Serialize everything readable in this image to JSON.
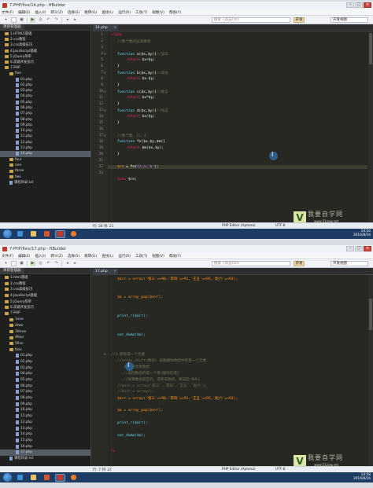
{
  "colors": {
    "editor_bg": "#272822",
    "keyword": "#f92672",
    "function": "#66d9ef",
    "comment": "#75715e",
    "string": "#e6db74",
    "variable": "#fd971f",
    "number": "#ae81ff",
    "taskbar": "#1d3b63"
  },
  "shot1": {
    "window_title": "7-PHP/five/14.php - HBuilder",
    "menu": [
      "文件(F)",
      "编辑(E)",
      "插入(I)",
      "转义(Z)",
      "选择(S)",
      "跳转(G)",
      "查找(L)",
      "运行(R)",
      "工具(T)",
      "视图(V)",
      "帮助(Y)"
    ],
    "search_placeholder": "搜索（双击Ctrl）",
    "mode_button": "开发",
    "view_select": "开发视图",
    "panel_title": "项目管理器",
    "tree": [
      "1.HTML5基础",
      "2.css教程",
      "3.css高级技巧",
      "4.JavaScript基础",
      "5.jQuery简单",
      "6.前端开发技巧",
      "7-PHP",
      "five",
      "01.php",
      "02.php",
      "03.php",
      "04.php",
      "05.php",
      "06.php",
      "07.php",
      "08.php",
      "09.php",
      "10.php",
      "11.php",
      "12.php",
      "13.php",
      "14.php",
      "four",
      "one",
      "three",
      "two",
      "课程目录.txt"
    ],
    "tab": "14.php",
    "lines": [
      "1",
      "2",
      "3",
      "4",
      "5",
      "6",
      "7",
      "8",
      "9",
      "10",
      "11",
      "12",
      "13",
      "14",
      "15",
      "16",
      "17",
      "18",
      "19",
      "20",
      "21",
      "22",
      "23"
    ],
    "code": {
      "l1": "<?php",
      "l2": "//两个数的加减乘除",
      "l4a": "function ",
      "l4b": "a($x,$y){",
      "l4c": "//加法",
      "l5a": "return ",
      "l5b": "$x+$y;",
      "l6": "}",
      "l8a": "function ",
      "l8b": "b($x,$y){",
      "l8c": "//减法",
      "l9a": "return ",
      "l9b": "$x-$y;",
      "l10": "}",
      "l12a": "function ",
      "l12b": "c($x,$y){",
      "l12c": "//乘法",
      "l13a": "return ",
      "l13b": "$x*$y;",
      "l14": "}",
      "l16a": "function ",
      "l16b": "d($x,$y){",
      "l16c": "//除法",
      "l17a": "return ",
      "l17b": "$x/$y;",
      "l18": "}",
      "l20": "//两个数，12，4",
      "l21a": "function ",
      "l21b": "fn($x,$y,$m){",
      "l22a": "return ",
      "l22b": "$m($x,$y);",
      "l23": "}",
      "l25a": "$re",
      "l25b": " = fn(",
      "l25c": "12,4,'b'",
      "l25d": ");",
      "l27a": "echo ",
      "l27b": "$re;"
    },
    "status_pos": "行: 26 列: 21",
    "status_editor": "PHP Editor (Aptana)",
    "status_enc": "UTF-8",
    "tray_time": "14:54",
    "tray_date": "2016/8/16",
    "logo_title": "我要自学网",
    "logo_sub": "www.51zxw.net"
  },
  "shot2": {
    "window_title": "7-PHP/6six/17.php - HBuilder",
    "menu": [
      "文件(F)",
      "编辑(E)",
      "插入(I)",
      "转义(Z)",
      "选择(S)",
      "跳转(G)",
      "查找(L)",
      "运行(R)",
      "工具(T)",
      "视图(V)",
      "帮助(Y)"
    ],
    "search_placeholder": "搜索（双击Ctrl）",
    "mode_button": "开发",
    "view_select": "开发视图",
    "panel_title": "项目管理器",
    "tree": [
      "1.html基础",
      "2.css教程",
      "3.css高级技巧",
      "4.JavaScript基础",
      "5.jQuery简单",
      "6.前端开发技巧",
      "7-PHP",
      "1one",
      "2two",
      "3three",
      "4four",
      "5five",
      "6six",
      "01.php",
      "02.php",
      "03.php",
      "04.php",
      "05.php",
      "06.php",
      "07.php",
      "08.php",
      "09.php",
      "10.php",
      "11.php",
      "12.php",
      "13.php",
      "14.php",
      "15.php",
      "16.php",
      "17.php",
      "课程目录.txt"
    ],
    "tab": "17.php",
    "code": {
      "a1": "$arr = array('张三'=>90,'李四'=>91,'王五'=>92,'赵六'=>93);",
      "a2": "$a = array_pop($arr);",
      "a3": "print_r($arr);",
      "a4": "var_dump($a);",
      "c1": "//3.删除第一个元素",
      "c2": "//array_shift(数组) 函数删除数组中的第一个元素.",
      "c3": "//重新改变数组",
      "c4": "//返回数组的第一个值(删除的值)",
      "c5": "//如果数组是空的，或者非数组，将返回 NULL",
      "c6": "//$arr = array('张三','李四','王五','赵六');",
      "c7": "//$arr = array();",
      "b1": "$arr = array('张三'=>90,'李四'=>91,'王五'=>92,'赵六'=>93);",
      "b2": "$a = array_pop($arr);",
      "b3": "print_r($arr);",
      "b4": "var_dump($a);",
      "end": "?>"
    },
    "status_pos": "行: 7 列: 27",
    "status_editor": "PHP Editor (Aptana)",
    "status_enc": "UTF-8",
    "tray_time": "14:58",
    "tray_date": "2016/8/16",
    "logo_title": "我要自学网",
    "logo_sub": "www.51zxw.net"
  }
}
